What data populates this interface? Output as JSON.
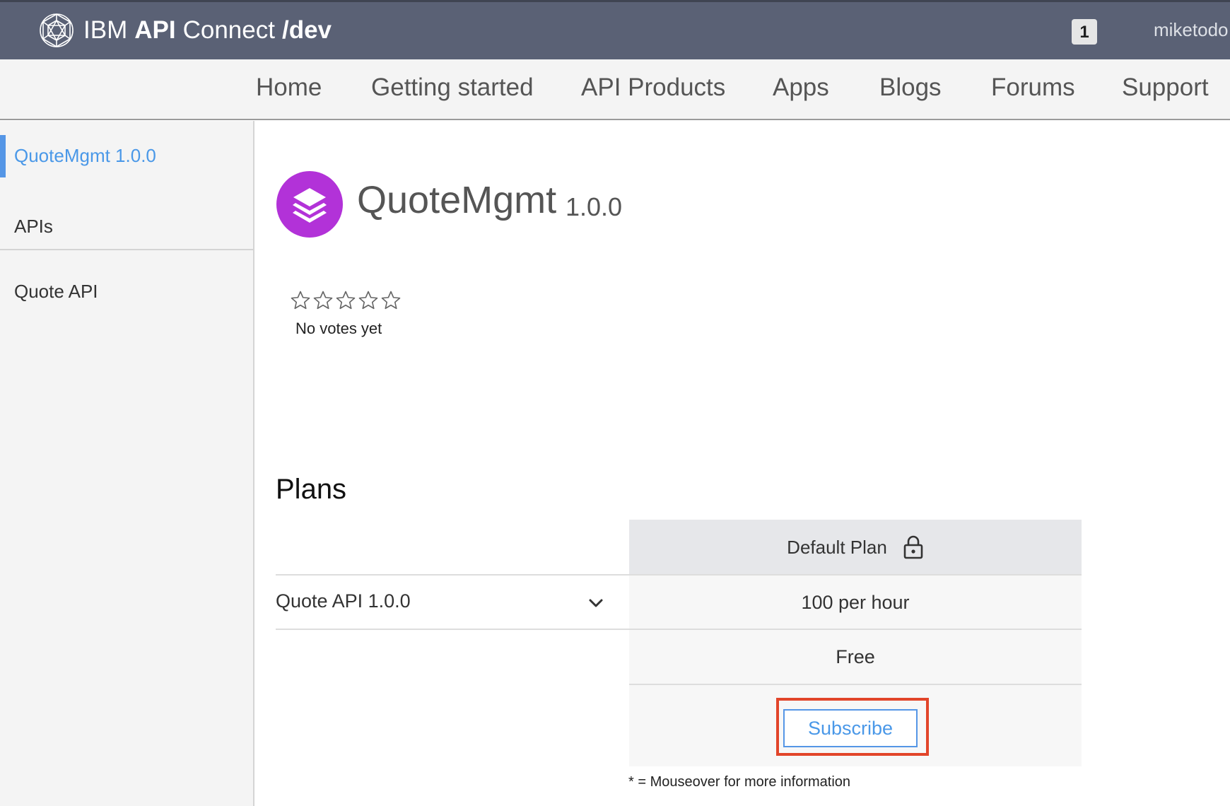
{
  "header": {
    "brand": {
      "ibm": "IBM",
      "api": "API",
      "connect": "Connect",
      "env": "/dev"
    },
    "notification_count": "1",
    "username": "miketodo",
    "logo_icon": "ibm-api-connect-logo-icon",
    "background_color": "#5a6175"
  },
  "nav": {
    "items": [
      "Home",
      "Getting started",
      "API Products",
      "Apps",
      "Blogs",
      "Forums",
      "Support"
    ]
  },
  "sidebar": {
    "active_item": "QuoteMgmt 1.0.0",
    "section_title": "APIs",
    "items": [
      "Quote API"
    ],
    "accent_color": "#5596e6"
  },
  "product": {
    "icon": "layers-icon",
    "icon_color": "#b232d8",
    "title": "QuoteMgmt",
    "version": "1.0.0",
    "rating_stars_filled": 0,
    "rating_stars_total": 5,
    "votes_text": "No votes yet"
  },
  "plans": {
    "heading": "Plans",
    "plan_name": "Default Plan",
    "plan_icon": "lock-icon",
    "api_row_label": "Quote API 1.0.0",
    "rate_limit": "100 per hour",
    "price": "Free",
    "subscribe_label": "Subscribe",
    "highlight_color": "#e2452a",
    "footnote": "* = Mouseover for more information"
  }
}
